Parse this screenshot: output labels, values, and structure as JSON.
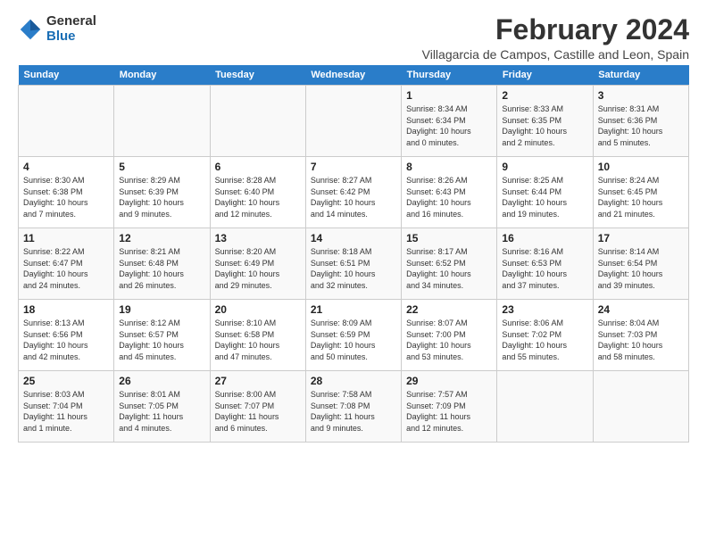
{
  "logo": {
    "general": "General",
    "blue": "Blue"
  },
  "header": {
    "title": "February 2024",
    "subtitle": "Villagarcia de Campos, Castille and Leon, Spain"
  },
  "weekdays": [
    "Sunday",
    "Monday",
    "Tuesday",
    "Wednesday",
    "Thursday",
    "Friday",
    "Saturday"
  ],
  "weeks": [
    [
      {
        "day": "",
        "info": ""
      },
      {
        "day": "",
        "info": ""
      },
      {
        "day": "",
        "info": ""
      },
      {
        "day": "",
        "info": ""
      },
      {
        "day": "1",
        "info": "Sunrise: 8:34 AM\nSunset: 6:34 PM\nDaylight: 10 hours\nand 0 minutes."
      },
      {
        "day": "2",
        "info": "Sunrise: 8:33 AM\nSunset: 6:35 PM\nDaylight: 10 hours\nand 2 minutes."
      },
      {
        "day": "3",
        "info": "Sunrise: 8:31 AM\nSunset: 6:36 PM\nDaylight: 10 hours\nand 5 minutes."
      }
    ],
    [
      {
        "day": "4",
        "info": "Sunrise: 8:30 AM\nSunset: 6:38 PM\nDaylight: 10 hours\nand 7 minutes."
      },
      {
        "day": "5",
        "info": "Sunrise: 8:29 AM\nSunset: 6:39 PM\nDaylight: 10 hours\nand 9 minutes."
      },
      {
        "day": "6",
        "info": "Sunrise: 8:28 AM\nSunset: 6:40 PM\nDaylight: 10 hours\nand 12 minutes."
      },
      {
        "day": "7",
        "info": "Sunrise: 8:27 AM\nSunset: 6:42 PM\nDaylight: 10 hours\nand 14 minutes."
      },
      {
        "day": "8",
        "info": "Sunrise: 8:26 AM\nSunset: 6:43 PM\nDaylight: 10 hours\nand 16 minutes."
      },
      {
        "day": "9",
        "info": "Sunrise: 8:25 AM\nSunset: 6:44 PM\nDaylight: 10 hours\nand 19 minutes."
      },
      {
        "day": "10",
        "info": "Sunrise: 8:24 AM\nSunset: 6:45 PM\nDaylight: 10 hours\nand 21 minutes."
      }
    ],
    [
      {
        "day": "11",
        "info": "Sunrise: 8:22 AM\nSunset: 6:47 PM\nDaylight: 10 hours\nand 24 minutes."
      },
      {
        "day": "12",
        "info": "Sunrise: 8:21 AM\nSunset: 6:48 PM\nDaylight: 10 hours\nand 26 minutes."
      },
      {
        "day": "13",
        "info": "Sunrise: 8:20 AM\nSunset: 6:49 PM\nDaylight: 10 hours\nand 29 minutes."
      },
      {
        "day": "14",
        "info": "Sunrise: 8:18 AM\nSunset: 6:51 PM\nDaylight: 10 hours\nand 32 minutes."
      },
      {
        "day": "15",
        "info": "Sunrise: 8:17 AM\nSunset: 6:52 PM\nDaylight: 10 hours\nand 34 minutes."
      },
      {
        "day": "16",
        "info": "Sunrise: 8:16 AM\nSunset: 6:53 PM\nDaylight: 10 hours\nand 37 minutes."
      },
      {
        "day": "17",
        "info": "Sunrise: 8:14 AM\nSunset: 6:54 PM\nDaylight: 10 hours\nand 39 minutes."
      }
    ],
    [
      {
        "day": "18",
        "info": "Sunrise: 8:13 AM\nSunset: 6:56 PM\nDaylight: 10 hours\nand 42 minutes."
      },
      {
        "day": "19",
        "info": "Sunrise: 8:12 AM\nSunset: 6:57 PM\nDaylight: 10 hours\nand 45 minutes."
      },
      {
        "day": "20",
        "info": "Sunrise: 8:10 AM\nSunset: 6:58 PM\nDaylight: 10 hours\nand 47 minutes."
      },
      {
        "day": "21",
        "info": "Sunrise: 8:09 AM\nSunset: 6:59 PM\nDaylight: 10 hours\nand 50 minutes."
      },
      {
        "day": "22",
        "info": "Sunrise: 8:07 AM\nSunset: 7:00 PM\nDaylight: 10 hours\nand 53 minutes."
      },
      {
        "day": "23",
        "info": "Sunrise: 8:06 AM\nSunset: 7:02 PM\nDaylight: 10 hours\nand 55 minutes."
      },
      {
        "day": "24",
        "info": "Sunrise: 8:04 AM\nSunset: 7:03 PM\nDaylight: 10 hours\nand 58 minutes."
      }
    ],
    [
      {
        "day": "25",
        "info": "Sunrise: 8:03 AM\nSunset: 7:04 PM\nDaylight: 11 hours\nand 1 minute."
      },
      {
        "day": "26",
        "info": "Sunrise: 8:01 AM\nSunset: 7:05 PM\nDaylight: 11 hours\nand 4 minutes."
      },
      {
        "day": "27",
        "info": "Sunrise: 8:00 AM\nSunset: 7:07 PM\nDaylight: 11 hours\nand 6 minutes."
      },
      {
        "day": "28",
        "info": "Sunrise: 7:58 AM\nSunset: 7:08 PM\nDaylight: 11 hours\nand 9 minutes."
      },
      {
        "day": "29",
        "info": "Sunrise: 7:57 AM\nSunset: 7:09 PM\nDaylight: 11 hours\nand 12 minutes."
      },
      {
        "day": "",
        "info": ""
      },
      {
        "day": "",
        "info": ""
      }
    ]
  ]
}
